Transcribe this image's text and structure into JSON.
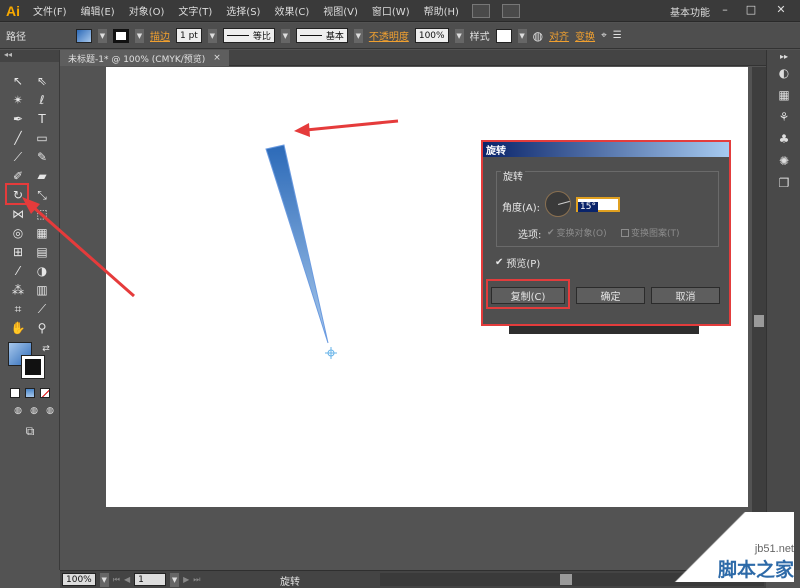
{
  "app": {
    "logo": "Ai"
  },
  "menu": [
    "文件(F)",
    "编辑(E)",
    "对象(O)",
    "文字(T)",
    "选择(S)",
    "效果(C)",
    "视图(V)",
    "窗口(W)",
    "帮助(H)"
  ],
  "workspace": "基本功能",
  "window_controls": {
    "minimize": "–",
    "maximize": "□",
    "close": "✕"
  },
  "control": {
    "object_type": "路径",
    "stroke_label": "描边",
    "stroke_weight": "1 pt",
    "profile_uniform": "等比",
    "brush_basic": "基本",
    "opacity_label": "不透明度",
    "opacity_value": "100%",
    "style_label": "样式",
    "align_label": "对齐",
    "transform_label": "变换"
  },
  "document_tab": {
    "title": "未标题-1* @ 100% (CMYK/预览)",
    "close": "×"
  },
  "status": {
    "zoom": "100%",
    "page": "1",
    "current_tool": "旋转"
  },
  "dialog": {
    "title": "旋转",
    "group_label": "旋转",
    "angle_label": "角度(A):",
    "angle_value": 15,
    "angle_text": "15°",
    "options_label": "选项:",
    "opt_transform_objects": "变换对象(O)",
    "opt_transform_pattern": "变换图案(T)",
    "opt_transform_objects_checked": true,
    "opt_transform_pattern_checked": false,
    "preview_label": "预览(P)",
    "preview_checked": true,
    "copy_button": "复制(C)",
    "ok_button": "确定",
    "cancel_button": "取消"
  },
  "colors": {
    "highlight_red": "#e33c3c",
    "shape_gradient_start": "#2c6ab8",
    "shape_gradient_end": "#a8c8ec",
    "accent_orange": "#f0a030"
  },
  "watermark": {
    "url": "jb51.net",
    "name": "脚本之家"
  }
}
